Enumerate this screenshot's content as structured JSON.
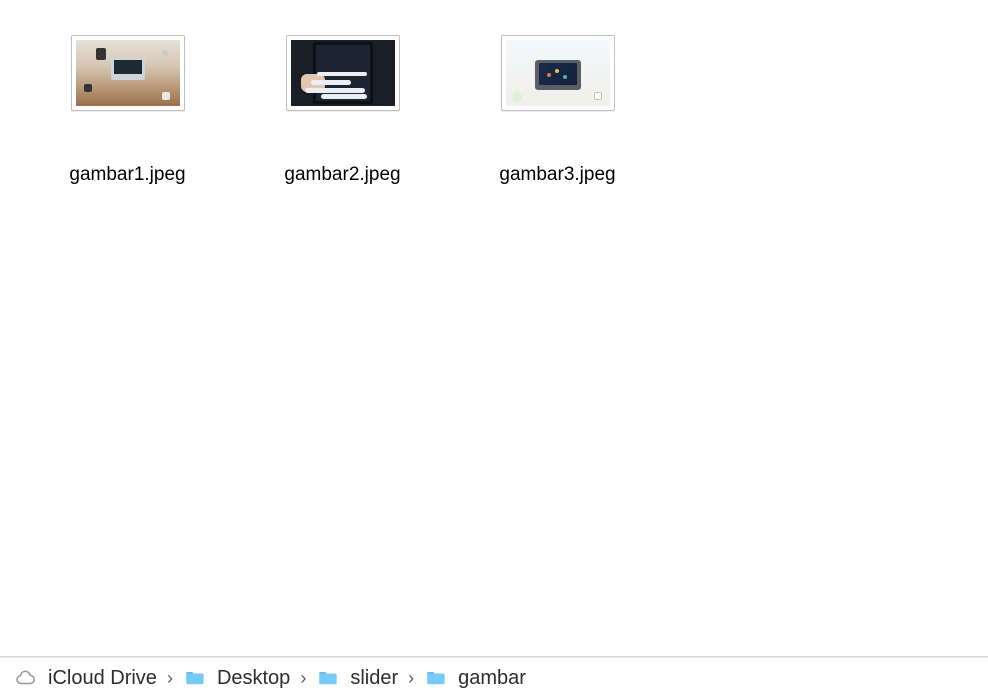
{
  "files": [
    {
      "name": "gambar1.jpeg"
    },
    {
      "name": "gambar2.jpeg"
    },
    {
      "name": "gambar3.jpeg"
    }
  ],
  "path": [
    {
      "label": "iCloud Drive",
      "icon": "cloud"
    },
    {
      "label": "Desktop",
      "icon": "folder"
    },
    {
      "label": "slider",
      "icon": "folder"
    },
    {
      "label": "gambar",
      "icon": "folder"
    }
  ],
  "separator": "›",
  "colors": {
    "folder_fill": "#76caf5",
    "folder_tab": "#5cb6e6",
    "cloud_stroke": "#9b9b9b"
  }
}
